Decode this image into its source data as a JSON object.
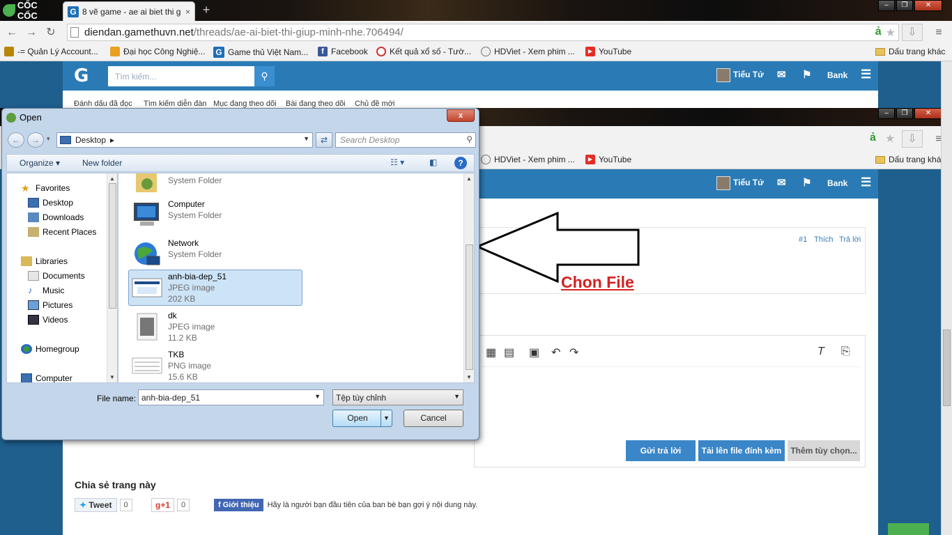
{
  "browser": {
    "app_name": "CỐC CỐC",
    "tab_title": "8 vẽ game - ae ai biet thi g",
    "tab_close": "×",
    "new_tab": "+",
    "url_host": "diendan.gamethuvn.net",
    "url_path": "/threads/ae-ai-biet-thi-giup-minh-nhe.706494/",
    "bookmarks": [
      {
        "label": "-= Quản Lý Account..."
      },
      {
        "label": "Đại học Công Nghiệ..."
      },
      {
        "label": "Game thủ Việt Nam..."
      },
      {
        "label": "Facebook"
      },
      {
        "label": "Kết quả xổ số - Tườ..."
      },
      {
        "label": "HDViet - Xem phim ..."
      },
      {
        "label": "YouTube"
      }
    ],
    "other_bookmarks": "Dấu trang khác"
  },
  "forum": {
    "logo": "G",
    "search_placeholder": "Tìm kiếm...",
    "user": "Tiểu Tứ",
    "bank": "Bank",
    "subnav": [
      "Đánh dấu đã đọc",
      "Tìm kiếm diễn đàn",
      "Mục đang theo dõi",
      "Bài đang theo dõi",
      "Chủ đề mới"
    ],
    "post_num": "#1",
    "like": "Thích",
    "reply": "Trả lời",
    "btn_submit": "Gửi trả lời",
    "btn_upload": "Tải lên file đính kèm",
    "btn_more": "Thêm tùy chọn...",
    "share_title": "Chia sẻ trang này",
    "tweet": "Tweet",
    "tweet_count": "0",
    "gplus": "g+1",
    "gplus_count": "0",
    "fb_intro": "Giới thiệu",
    "fb_text": "Hãy là người bạn đầu tiên của ban bè bạn gợi ý nội dung này."
  },
  "annotation": {
    "label": "Chon File",
    "color": "#d32222"
  },
  "dialog": {
    "title": "Open",
    "close": "x",
    "location": "Desktop",
    "search_placeholder": "Search Desktop",
    "organize": "Organize",
    "new_folder": "New folder",
    "help": "?",
    "nav": {
      "favorites": "Favorites",
      "desktop": "Desktop",
      "downloads": "Downloads",
      "recent": "Recent Places",
      "libraries": "Libraries",
      "documents": "Documents",
      "music": "Music",
      "pictures": "Pictures",
      "videos": "Videos",
      "homegroup": "Homegroup",
      "computer": "Computer"
    },
    "partial_item_type": "System Folder",
    "files": [
      {
        "name": "Computer",
        "type": "System Folder",
        "size": ""
      },
      {
        "name": "Network",
        "type": "System Folder",
        "size": ""
      },
      {
        "name": "anh-bia-dep_51",
        "type": "JPEG image",
        "size": "202 KB"
      },
      {
        "name": "dk",
        "type": "JPEG image",
        "size": "11.2 KB"
      },
      {
        "name": "TKB",
        "type": "PNG image",
        "size": "15.6 KB"
      }
    ],
    "file_name_label": "File name:",
    "file_name_value": "anh-bia-dep_51",
    "file_type": "Tệp tùy chỉnh",
    "open_btn": "Open",
    "cancel_btn": "Cancel"
  }
}
